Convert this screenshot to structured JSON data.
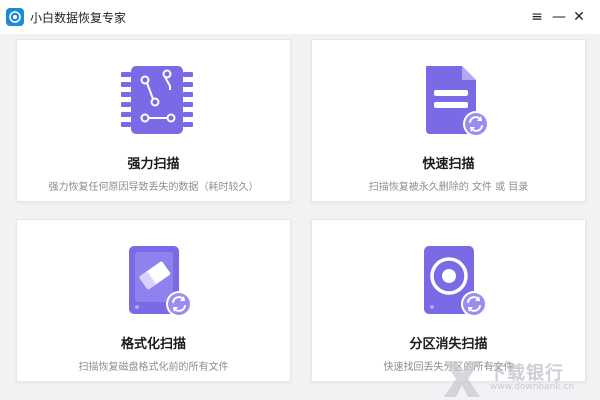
{
  "window": {
    "title": "小白数据恢复专家",
    "menu_glyph": "≡",
    "minimize_glyph": "—",
    "close_glyph": "✕"
  },
  "colors": {
    "accent": "#7b6ae6",
    "accent_light": "#9a8df0",
    "logo_blue": "#1f8ad6"
  },
  "cards": [
    {
      "title": "强力扫描",
      "desc": "强力恢复任何原因导致丢失的数据（耗时较久）",
      "icon": "chip-icon"
    },
    {
      "title": "快速扫描",
      "desc": "扫描恢复被永久删除的 文件 或 目录",
      "icon": "document-refresh-icon"
    },
    {
      "title": "格式化扫描",
      "desc": "扫描恢复磁盘格式化前的所有文件",
      "icon": "eraser-drive-refresh-icon"
    },
    {
      "title": "分区消失扫描",
      "desc": "快速找回丢失分区的所有文件",
      "icon": "disk-drive-refresh-icon"
    }
  ],
  "watermark": {
    "text": "下载银行",
    "sub": "www.downbank.cn"
  }
}
